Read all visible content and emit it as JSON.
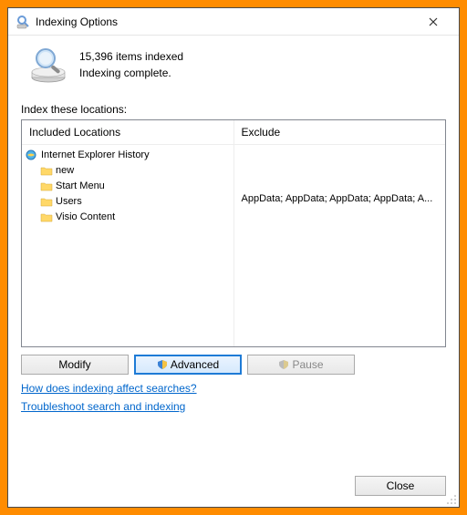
{
  "dialog": {
    "title": "Indexing Options",
    "close_x": "✕"
  },
  "status": {
    "count_line": "15,396 items indexed",
    "state_line": "Indexing complete."
  },
  "section_label": "Index these locations:",
  "columns": {
    "included_header": "Included Locations",
    "exclude_header": "Exclude"
  },
  "included": [
    {
      "label": "Internet Explorer History",
      "icon": "ie",
      "indent": false
    },
    {
      "label": "new",
      "icon": "folder",
      "indent": true
    },
    {
      "label": "Start Menu",
      "icon": "folder",
      "indent": true
    },
    {
      "label": "Users",
      "icon": "folder",
      "indent": true
    },
    {
      "label": "Visio Content",
      "icon": "folder",
      "indent": true
    }
  ],
  "exclude": [
    "",
    "",
    "",
    "AppData; AppData; AppData; AppData; A...",
    ""
  ],
  "buttons": {
    "modify": "Modify",
    "advanced": "Advanced",
    "pause": "Pause",
    "close": "Close"
  },
  "links": {
    "how": "How does indexing affect searches?",
    "troubleshoot": "Troubleshoot search and indexing"
  }
}
